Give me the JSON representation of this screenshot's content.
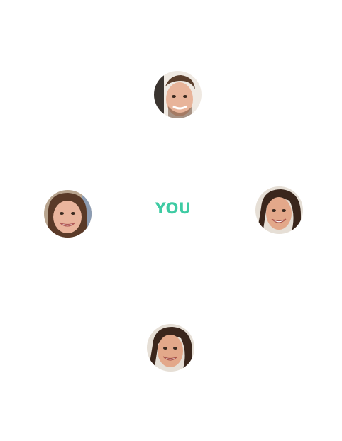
{
  "center": {
    "label": "YOU",
    "color": "#3ecba3"
  },
  "avatars": [
    {
      "id": "top",
      "icon": "person-avatar-icon"
    },
    {
      "id": "left",
      "icon": "person-avatar-icon"
    },
    {
      "id": "right",
      "icon": "person-avatar-icon"
    },
    {
      "id": "bottom",
      "icon": "person-avatar-icon"
    }
  ]
}
